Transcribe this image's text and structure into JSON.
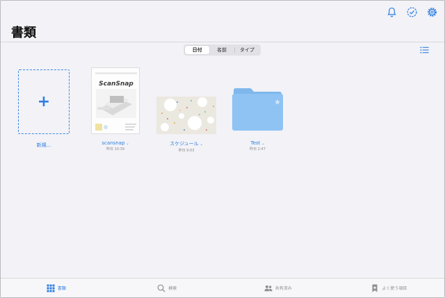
{
  "header": {
    "title": "書類",
    "icons": [
      "bell-icon",
      "checkmark-circle-icon",
      "gear-icon"
    ]
  },
  "sort": {
    "options": [
      "日付",
      "名前",
      "タイプ"
    ],
    "selected": "日付"
  },
  "items": [
    {
      "kind": "new",
      "label": "新規..."
    },
    {
      "kind": "document",
      "label": "scansnap",
      "sub": "昨日 10:39"
    },
    {
      "kind": "document",
      "label": "スケジュール",
      "sub": "昨日 9:03"
    },
    {
      "kind": "folder",
      "label": "Test",
      "sub": "昨日 2:47"
    }
  ],
  "tabs": [
    {
      "label": "書類",
      "icon": "grid-icon",
      "active": true
    },
    {
      "label": "検索",
      "icon": "search-icon",
      "active": false
    },
    {
      "label": "共有済み",
      "icon": "people-icon",
      "active": false
    },
    {
      "label": "よく使う項目",
      "icon": "bookmark-icon",
      "active": false
    }
  ],
  "thumbnail_text": {
    "scansnap_logo": "ScanSnap"
  },
  "colors": {
    "accent": "#2f7fdf",
    "folder": "#8ec3f4"
  }
}
